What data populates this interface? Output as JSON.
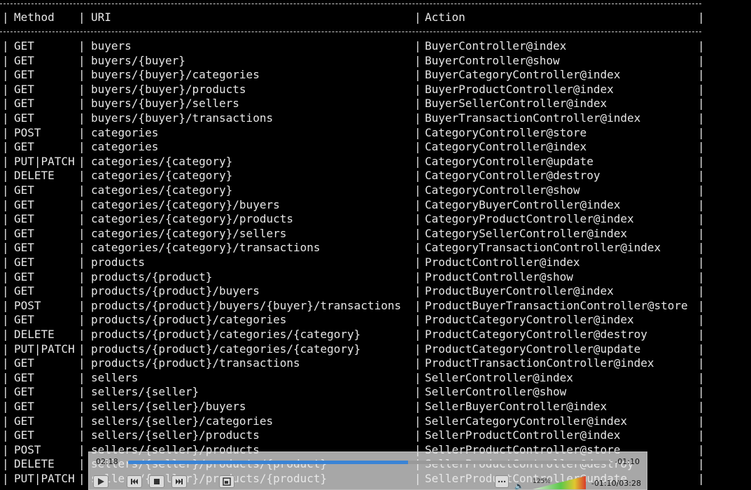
{
  "table": {
    "headers": {
      "method": "Method",
      "uri": "URI",
      "action": "Action"
    },
    "rows": [
      {
        "method": "GET",
        "uri": "buyers",
        "action": "BuyerController@index"
      },
      {
        "method": "GET",
        "uri": "buyers/{buyer}",
        "action": "BuyerController@show"
      },
      {
        "method": "GET",
        "uri": "buyers/{buyer}/categories",
        "action": "BuyerCategoryController@index"
      },
      {
        "method": "GET",
        "uri": "buyers/{buyer}/products",
        "action": "BuyerProductController@index"
      },
      {
        "method": "GET",
        "uri": "buyers/{buyer}/sellers",
        "action": "BuyerSellerController@index"
      },
      {
        "method": "GET",
        "uri": "buyers/{buyer}/transactions",
        "action": "BuyerTransactionController@index"
      },
      {
        "method": "POST",
        "uri": "categories",
        "action": "CategoryController@store"
      },
      {
        "method": "GET",
        "uri": "categories",
        "action": "CategoryController@index"
      },
      {
        "method": "PUT|PATCH",
        "uri": "categories/{category}",
        "action": "CategoryController@update"
      },
      {
        "method": "DELETE",
        "uri": "categories/{category}",
        "action": "CategoryController@destroy"
      },
      {
        "method": "GET",
        "uri": "categories/{category}",
        "action": "CategoryController@show"
      },
      {
        "method": "GET",
        "uri": "categories/{category}/buyers",
        "action": "CategoryBuyerController@index"
      },
      {
        "method": "GET",
        "uri": "categories/{category}/products",
        "action": "CategoryProductController@index"
      },
      {
        "method": "GET",
        "uri": "categories/{category}/sellers",
        "action": "CategorySellerController@index"
      },
      {
        "method": "GET",
        "uri": "categories/{category}/transactions",
        "action": "CategoryTransactionController@index"
      },
      {
        "method": "GET",
        "uri": "products",
        "action": "ProductController@index"
      },
      {
        "method": "GET",
        "uri": "products/{product}",
        "action": "ProductController@show"
      },
      {
        "method": "GET",
        "uri": "products/{product}/buyers",
        "action": "ProductBuyerController@index"
      },
      {
        "method": "POST",
        "uri": "products/{product}/buyers/{buyer}/transactions",
        "action": "ProductBuyerTransactionController@store"
      },
      {
        "method": "GET",
        "uri": "products/{product}/categories",
        "action": "ProductCategoryController@index"
      },
      {
        "method": "DELETE",
        "uri": "products/{product}/categories/{category}",
        "action": "ProductCategoryController@destroy"
      },
      {
        "method": "PUT|PATCH",
        "uri": "products/{product}/categories/{category}",
        "action": "ProductCategoryController@update"
      },
      {
        "method": "GET",
        "uri": "products/{product}/transactions",
        "action": "ProductTransactionController@index"
      },
      {
        "method": "GET",
        "uri": "sellers",
        "action": "SellerController@index"
      },
      {
        "method": "GET",
        "uri": "sellers/{seller}",
        "action": "SellerController@show"
      },
      {
        "method": "GET",
        "uri": "sellers/{seller}/buyers",
        "action": "SellerBuyerController@index"
      },
      {
        "method": "GET",
        "uri": "sellers/{seller}/categories",
        "action": "SellerCategoryController@index"
      },
      {
        "method": "GET",
        "uri": "sellers/{seller}/products",
        "action": "SellerProductController@index"
      },
      {
        "method": "POST",
        "uri": "sellers/{seller}/products",
        "action": "SellerProductController@store"
      },
      {
        "method": "DELETE",
        "uri": "sellers/{seller}/products/{product}",
        "action": "SellerProductController@destroy"
      },
      {
        "method": "PUT|PATCH",
        "uri": "sellers/{seller}/products/{product}",
        "action": "SellerProductController@update"
      }
    ]
  },
  "player": {
    "time_elapsed": "02:18",
    "time_remaining": "-01:10",
    "time_total": "-01:10/03:28",
    "zoom": "125%",
    "progress_fraction": 0.58,
    "accent_color": "#3a84d6",
    "controls": {
      "play_icon": "play-icon",
      "prev_icon": "skip-back-icon",
      "stop_icon": "stop-icon",
      "next_icon": "skip-forward-icon",
      "fullscreen_icon": "fullscreen-icon",
      "loop_icon": "loop-icon",
      "volume_icon": "speaker-icon"
    }
  },
  "colors": {
    "terminal_bg": "#000000",
    "terminal_text": "#e6e6e6",
    "border": "#d0d0d0"
  }
}
